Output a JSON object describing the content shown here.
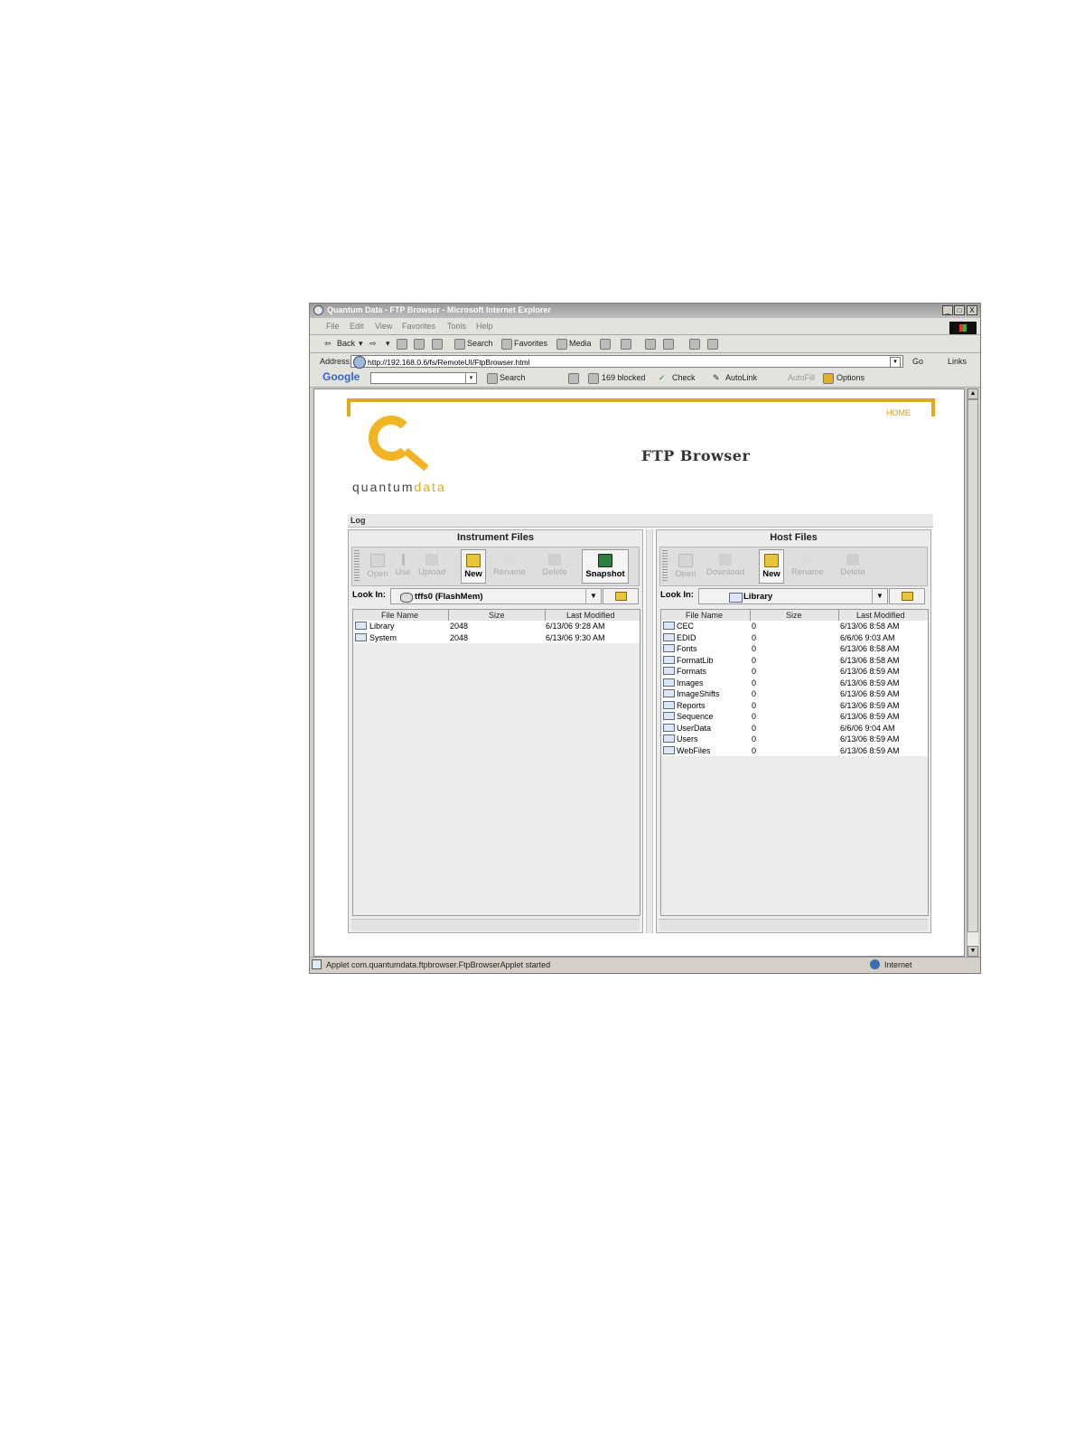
{
  "window": {
    "title": "Quantum Data - FTP Browser - Microsoft Internet Explorer",
    "controls": [
      "_",
      "□",
      "X"
    ]
  },
  "menu": [
    "File",
    "Edit",
    "View",
    "Favorites",
    "Tools",
    "Help"
  ],
  "toolbar": {
    "back": "Back",
    "search": "Search",
    "favorites": "Favorites",
    "media": "Media"
  },
  "address": {
    "label": "Address",
    "url": "http://192.168.0.6/fs/RemoteUI/FtpBrowser.html",
    "go": "Go",
    "links": "Links"
  },
  "googlebar": {
    "brand": "Google",
    "search": "Search",
    "blocked": "169 blocked",
    "check": "Check",
    "autolink": "AutoLink",
    "autofill": "AutoFill",
    "options": "Options"
  },
  "page": {
    "home_link": "HOME",
    "logo_word_1": "quantum",
    "logo_word_2": "data",
    "title": "FTP Browser",
    "log_label": "Log"
  },
  "instrument": {
    "title": "Instrument Files",
    "buttons": [
      "Open",
      "Use",
      "Upload",
      "New",
      "Rename",
      "Delete",
      "Snapshot"
    ],
    "look_in_label": "Look In:",
    "look_in_value": "tffs0   (FlashMem)",
    "columns": [
      "File Name",
      "Size",
      "Last Modified"
    ],
    "rows": [
      {
        "name": "Library",
        "size": "2048",
        "modified": "6/13/06 9:28 AM"
      },
      {
        "name": "System",
        "size": "2048",
        "modified": "6/13/06 9:30 AM"
      }
    ]
  },
  "host": {
    "title": "Host Files",
    "buttons": [
      "Open",
      "Download",
      "New",
      "Rename",
      "Delete"
    ],
    "look_in_label": "Look In:",
    "look_in_value": "Library",
    "columns": [
      "File Name",
      "Size",
      "Last Modified"
    ],
    "rows": [
      {
        "name": "CEC",
        "size": "0",
        "modified": "6/13/06 8:58 AM"
      },
      {
        "name": "EDID",
        "size": "0",
        "modified": "6/6/06 9:03 AM"
      },
      {
        "name": "Fonts",
        "size": "0",
        "modified": "6/13/06 8:58 AM"
      },
      {
        "name": "FormatLib",
        "size": "0",
        "modified": "6/13/06 8:58 AM"
      },
      {
        "name": "Formats",
        "size": "0",
        "modified": "6/13/06 8:59 AM"
      },
      {
        "name": "Images",
        "size": "0",
        "modified": "6/13/06 8:59 AM"
      },
      {
        "name": "ImageShifts",
        "size": "0",
        "modified": "6/13/06 8:59 AM"
      },
      {
        "name": "Reports",
        "size": "0",
        "modified": "6/13/06 8:59 AM"
      },
      {
        "name": "Sequence",
        "size": "0",
        "modified": "6/13/06 8:59 AM"
      },
      {
        "name": "UserData",
        "size": "0",
        "modified": "6/6/06 9:04 AM"
      },
      {
        "name": "Users",
        "size": "0",
        "modified": "6/13/06 8:59 AM"
      },
      {
        "name": "WebFiles",
        "size": "0",
        "modified": "6/13/06 8:59 AM"
      }
    ]
  },
  "status": {
    "text": "Applet com.quantumdata.ftpbrowser.FtpBrowserApplet started",
    "zone": "Internet"
  },
  "colors": {
    "accent": "#e0a81a",
    "logo": "#f2b324"
  },
  "icons": [
    "ie-icon",
    "folder-icon",
    "up-folder-icon",
    "new-folder-icon",
    "snapshot-icon",
    "globe-icon"
  ]
}
